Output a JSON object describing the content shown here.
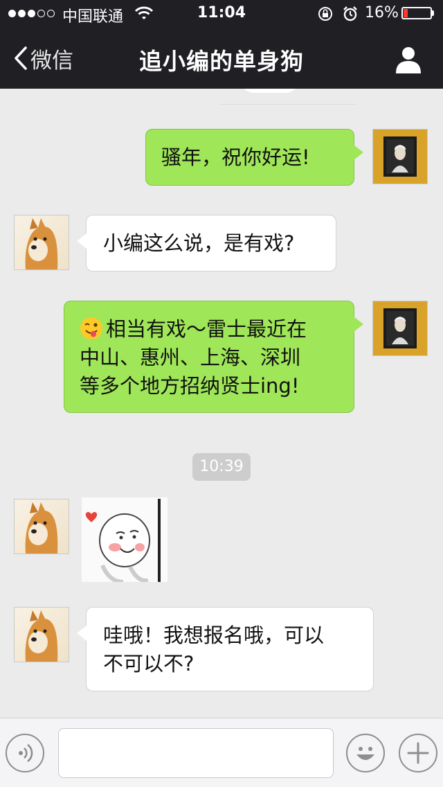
{
  "status_bar": {
    "carrier": "中国联通",
    "time": "11:04",
    "battery_percent": "16%",
    "battery_level": 0.16,
    "signal_bars_filled": 3,
    "signal_bars_total": 5,
    "icons": [
      "wifi-icon",
      "orientation-lock-icon",
      "alarm-icon",
      "battery-icon"
    ]
  },
  "nav": {
    "back_label": "微信",
    "title": "追小编的单身狗",
    "right_icon": "profile-icon"
  },
  "messages": [
    {
      "from": "me",
      "text": "骚年，祝你好运!"
    },
    {
      "from": "other",
      "text": "小编这么说，是有戏?"
    },
    {
      "from": "me",
      "emoji": "wink-tongue-emoji",
      "lines": [
        "相当有戏～雷士最近在",
        "中山、惠州、上海、深圳",
        "等多个地方招纳贤士ing!"
      ]
    },
    {
      "from": "other",
      "sticker": "peeking-face-sticker"
    },
    {
      "from": "other",
      "lines": [
        "哇哦！我想报名哦，可以",
        "不可以不?"
      ]
    }
  ],
  "time_divider": "10:39",
  "colors": {
    "nav_bg": "#1f1f24",
    "chat_bg": "#ebebeb",
    "outgoing_bubble": "#9fe658",
    "incoming_bubble": "#ffffff",
    "battery_low": "#ff3b30"
  },
  "toolbar": {
    "icons": [
      "voice-icon",
      "emoji-icon",
      "plus-icon"
    ],
    "input_value": ""
  }
}
